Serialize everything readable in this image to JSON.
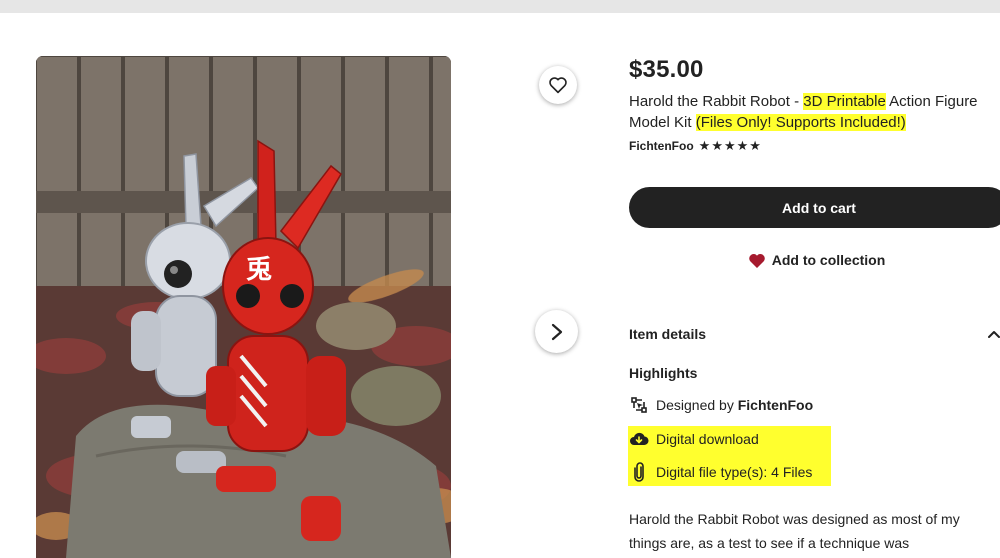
{
  "product": {
    "price": "$35.00",
    "title_parts": {
      "t1": "Harold the Rabbit Robot - ",
      "t2": "3D Printable",
      "t3": " Action Figure Model Kit ",
      "t4": "(Files Only! Supports Included!)"
    },
    "shop_name": "FichtenFoo",
    "rating_stars": 5,
    "image_alt": "Photo of a silver and a red rabbit robot action figure on a rock with autumn leaves"
  },
  "actions": {
    "add_to_cart": "Add to cart",
    "add_to_collection": "Add to collection"
  },
  "item_details": {
    "label": "Item details",
    "highlights_label": "Highlights",
    "designed_by_prefix": "Designed by ",
    "designed_by_name": "FichtenFoo",
    "digital_download": "Digital download",
    "file_types": "Digital file type(s): 4 Files"
  },
  "description": "Harold the Rabbit Robot was designed as most of my things are, as a test to see if a technique was",
  "icons": {
    "favorite": "heart-outline-icon",
    "next": "chevron-right-icon",
    "collection": "heart-filled-icon",
    "collapse": "chevron-up-icon",
    "designer": "designer-icon",
    "download": "cloud-download-icon",
    "files": "paperclip-icon"
  },
  "colors": {
    "highlight": "#ffff2e",
    "cart_button": "#222222",
    "collection_heart": "#a61a2e",
    "star": "#222222"
  }
}
